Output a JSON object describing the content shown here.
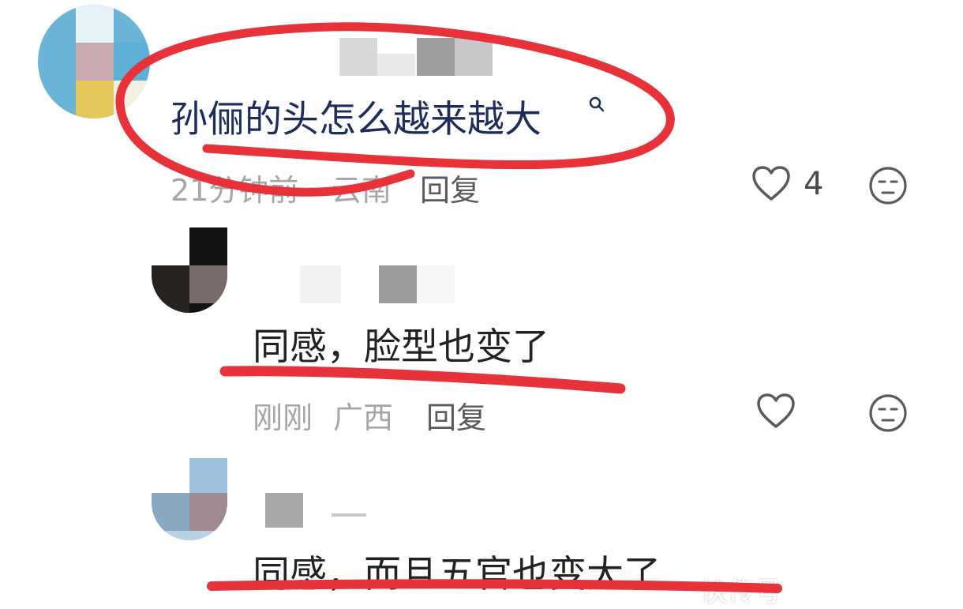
{
  "comments": [
    {
      "text": "孙俪的头怎么越来越大",
      "search_icon": "search-icon",
      "time": "21分钟前",
      "location": "云南",
      "reply_label": "回复",
      "like_count": "4"
    },
    {
      "text": "同感，脸型也变了",
      "time": "刚刚",
      "location": "广西",
      "reply_label": "回复",
      "like_count": ""
    },
    {
      "text": "同感，而且五官也变大了"
    }
  ],
  "watermark": "快传号",
  "colors": {
    "comment_text_first": "#1c2c5b",
    "comment_text_reply": "#222222",
    "meta": "#a6a6a6",
    "reply": "#5a5a5a",
    "annotation_red": "#e8323a"
  },
  "icons": [
    "heart-icon",
    "emoji-icon",
    "search-icon"
  ]
}
